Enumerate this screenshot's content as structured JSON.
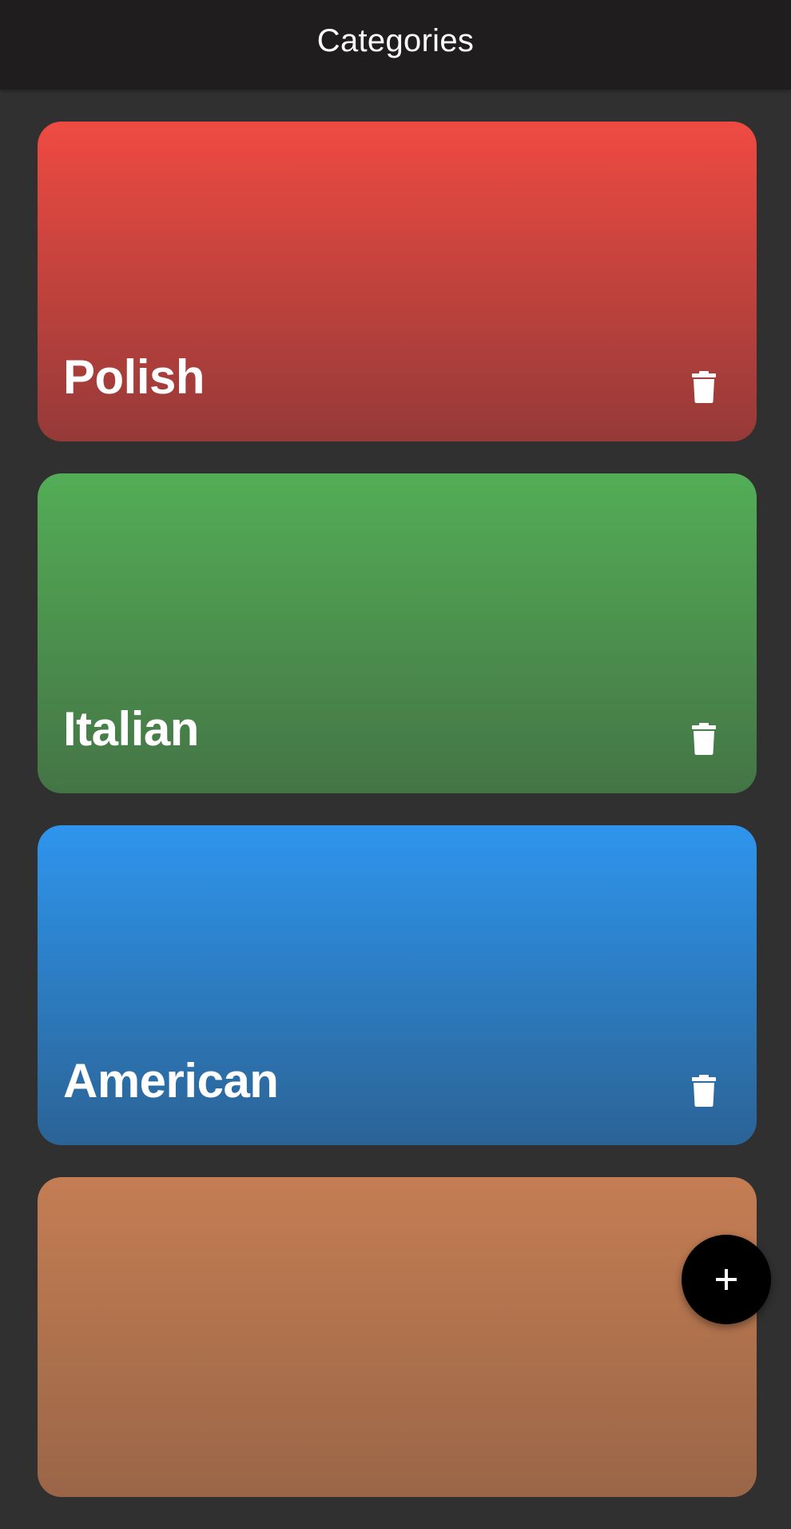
{
  "app_bar": {
    "title": "Categories"
  },
  "categories": [
    {
      "name": "Polish",
      "gradient": {
        "top": "#ef4a42",
        "bottom": "#953a38"
      },
      "delete_icon": "trash-icon"
    },
    {
      "name": "Italian",
      "gradient": {
        "top": "#53ad56",
        "bottom": "#447445"
      },
      "delete_icon": "trash-icon"
    },
    {
      "name": "American",
      "gradient": {
        "top": "#2e95ed",
        "bottom": "#2b6395"
      },
      "delete_icon": "trash-icon"
    },
    {
      "name": "",
      "gradient": {
        "top": "#c47d53",
        "bottom": "#9a6647"
      },
      "delete_icon": "trash-icon"
    }
  ],
  "fab": {
    "label": "+",
    "icon": "plus-icon"
  }
}
